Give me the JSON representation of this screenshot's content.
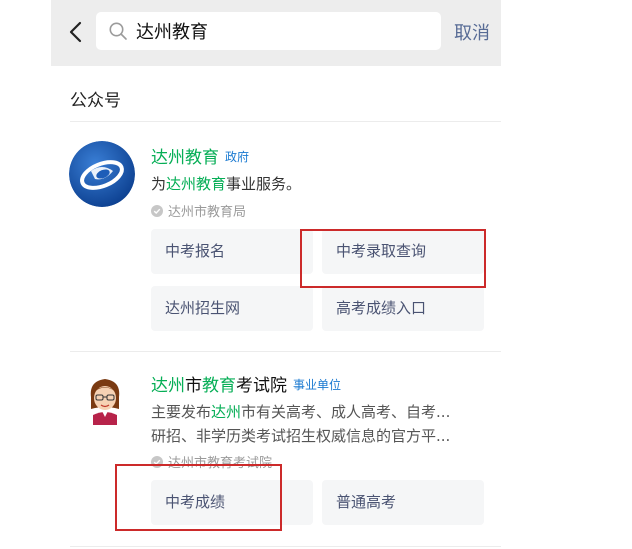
{
  "search": {
    "query": "达州教育",
    "cancel_label": "取消"
  },
  "section": {
    "title": "公众号"
  },
  "accounts": [
    {
      "name_hl": "达州教育",
      "tag": "政府",
      "desc_prefix": "为",
      "desc_hl": "达州教育",
      "desc_suffix": "事业服务。",
      "verified_by": "达州市教育局",
      "menu": [
        "中考报名",
        "中考录取查询",
        "达州招生网",
        "高考成绩入口"
      ]
    },
    {
      "name_parts": [
        "达州",
        "市",
        "教育",
        "考试院"
      ],
      "tag": "事业单位",
      "desc_line1_prefix": "主要发布",
      "desc_line1_hl": "达州",
      "desc_line1_suffix": "市有关高考、成人高考、自考...",
      "desc_line2": "研招、非学历类考试招生权威信息的官方平...",
      "verified_by": "达州市教育考试院",
      "menu": [
        "中考成绩",
        "普通高考"
      ]
    }
  ],
  "colors": {
    "highlight": "#06ae56",
    "link_blue": "#576b95",
    "tag_blue": "#1b7ad1",
    "annotation_red": "#cc2a2a"
  },
  "icons": {
    "back": "chevron-left-icon",
    "search": "search-icon",
    "verified": "verified-check-icon"
  }
}
